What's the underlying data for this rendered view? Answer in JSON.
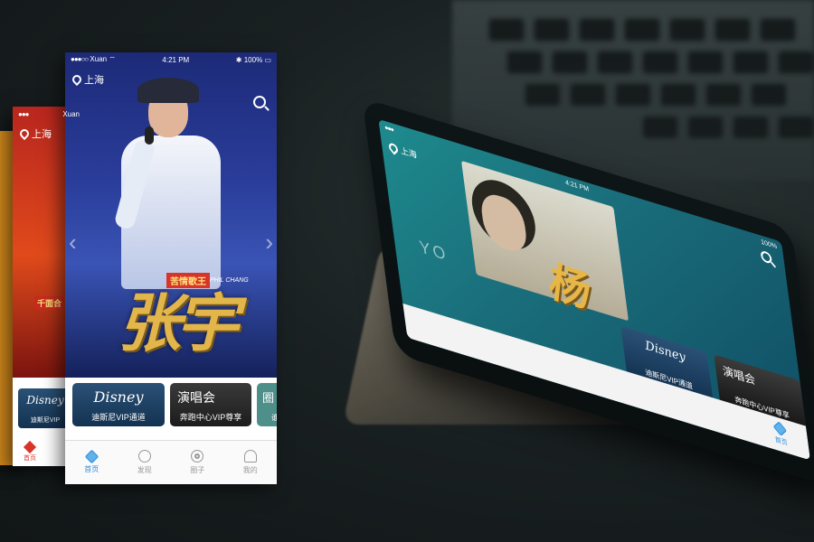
{
  "status_bar": {
    "carrier": "Xuan",
    "time": "4:21 PM",
    "battery": "100%"
  },
  "location": "上海",
  "hero": {
    "badge": "苦情歌王",
    "english_name": "PHIL CHANG",
    "title": "张宇"
  },
  "mid_screen": {
    "location": "上海",
    "badge": "千面合",
    "card_label": "迪斯尼VIP",
    "tab_label": "首页"
  },
  "cards": [
    {
      "logo": "Disney",
      "label": "迪斯尼VIP通道"
    },
    {
      "title": "演唱会",
      "label": "奔跑中心VIP尊享"
    },
    {
      "title": "圈",
      "label": "谁"
    }
  ],
  "tabs": [
    {
      "label": "首页",
      "icon": "diamond-icon",
      "active": true
    },
    {
      "label": "发现",
      "icon": "compass-icon",
      "active": false
    },
    {
      "label": "圈子",
      "icon": "disc-icon",
      "active": false
    },
    {
      "label": "我的",
      "icon": "user-icon",
      "active": false
    }
  ],
  "tilted_screen": {
    "location": "上海",
    "time": "4:21 PM",
    "battery": "100%",
    "yo": "YO",
    "title": "杨",
    "cards": [
      {
        "logo": "Disney",
        "label": "迪斯尼VIP通道"
      },
      {
        "title": "演唱会",
        "label": "奔跑中心VIP尊享"
      }
    ],
    "tab_label": "首页"
  },
  "colors": {
    "accent": "#2f8cde",
    "hero_gold": "#e2b64b",
    "badge_red": "#d8342a",
    "teal_bg": "#1e8b8e"
  }
}
